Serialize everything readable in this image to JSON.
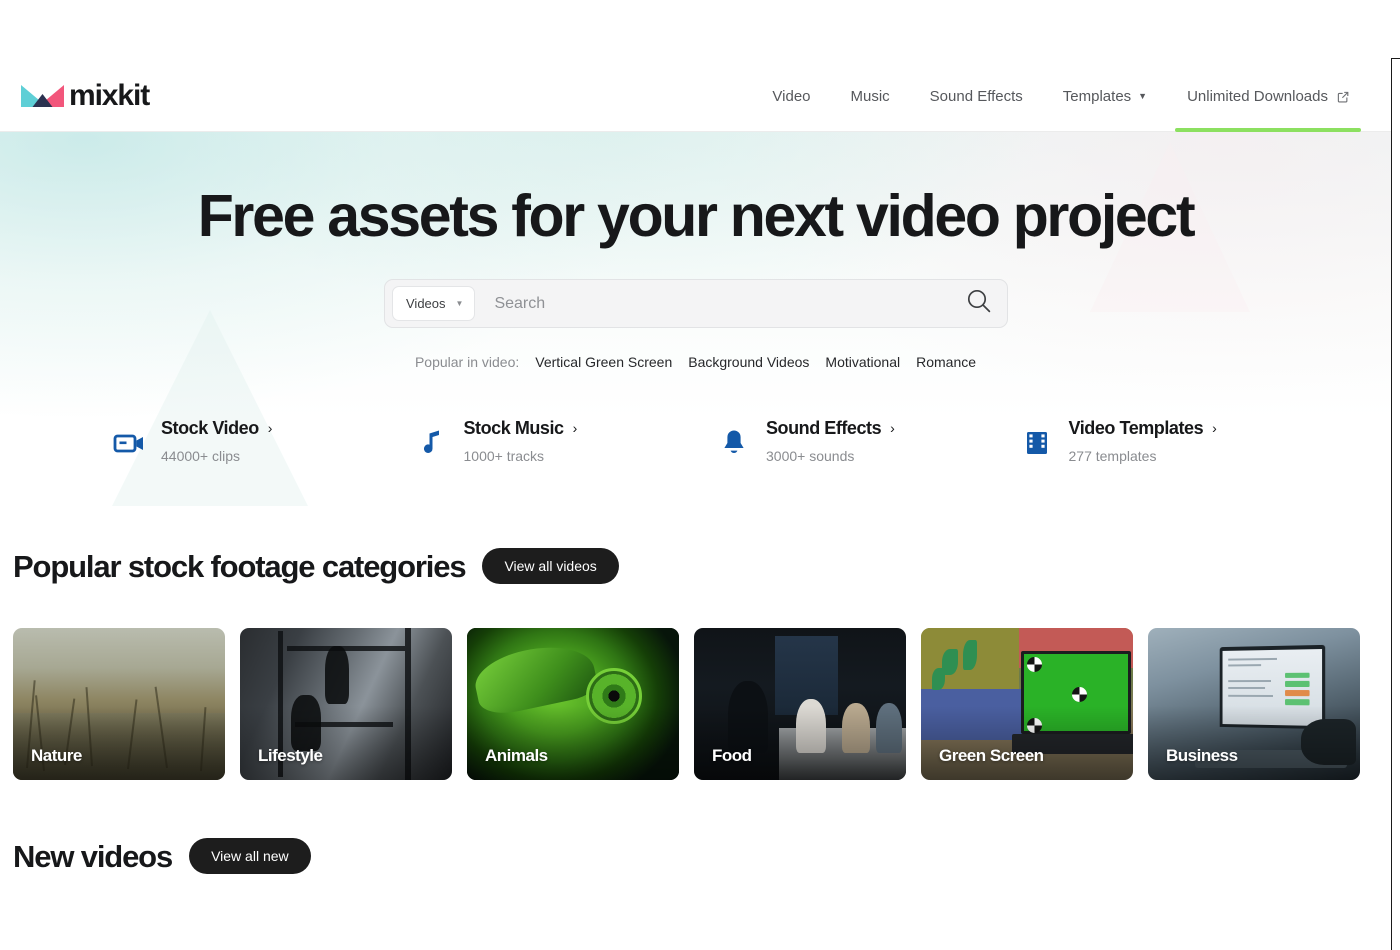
{
  "brand": {
    "name": "mixkit",
    "logo_icon": "mixkit-m-logo-icon",
    "logo_colors": {
      "teal": "#5ECFD6",
      "pink": "#F2567B",
      "navy": "#2B3250"
    }
  },
  "nav": {
    "items": [
      {
        "label": "Video",
        "icon": null,
        "active": false
      },
      {
        "label": "Music",
        "icon": null,
        "active": false
      },
      {
        "label": "Sound Effects",
        "icon": null,
        "active": false
      },
      {
        "label": "Templates",
        "icon": "chevron-down-icon",
        "active": false
      },
      {
        "label": "Unlimited Downloads",
        "icon": "external-link-icon",
        "active": true
      }
    ],
    "active_underline_color": "#8CE060"
  },
  "hero": {
    "title": "Free assets for your next video project"
  },
  "search": {
    "type_selected": "Videos",
    "type_caret_icon": "chevron-down-icon",
    "placeholder": "Search",
    "value": "",
    "submit_icon": "search-icon"
  },
  "popular": {
    "label": "Popular in video:",
    "tags": [
      "Vertical Green Screen",
      "Background Videos",
      "Motivational",
      "Romance"
    ]
  },
  "quicklinks": [
    {
      "icon": "video-camera-icon",
      "title": "Stock Video",
      "chevron": "›",
      "sub": "44000+ clips",
      "color": "#1459A8"
    },
    {
      "icon": "music-note-icon",
      "title": "Stock Music",
      "chevron": "›",
      "sub": "1000+ tracks",
      "color": "#1459A8"
    },
    {
      "icon": "bell-icon",
      "title": "Sound Effects",
      "chevron": "›",
      "sub": "3000+ sounds",
      "color": "#1459A8"
    },
    {
      "icon": "film-strip-icon",
      "title": "Video Templates",
      "chevron": "›",
      "sub": "277 templates",
      "color": "#1459A8"
    }
  ],
  "sections": {
    "categories": {
      "title": "Popular stock footage categories",
      "button": "View all videos",
      "cards": [
        {
          "label": "Nature",
          "art": "art-nature"
        },
        {
          "label": "Lifestyle",
          "art": "art-lifestyle"
        },
        {
          "label": "Animals",
          "art": "art-animals"
        },
        {
          "label": "Food",
          "art": "art-food"
        },
        {
          "label": "Green Screen",
          "art": "art-green"
        },
        {
          "label": "Business",
          "art": "art-business"
        }
      ]
    },
    "new_videos": {
      "title": "New videos",
      "button": "View all new"
    }
  }
}
